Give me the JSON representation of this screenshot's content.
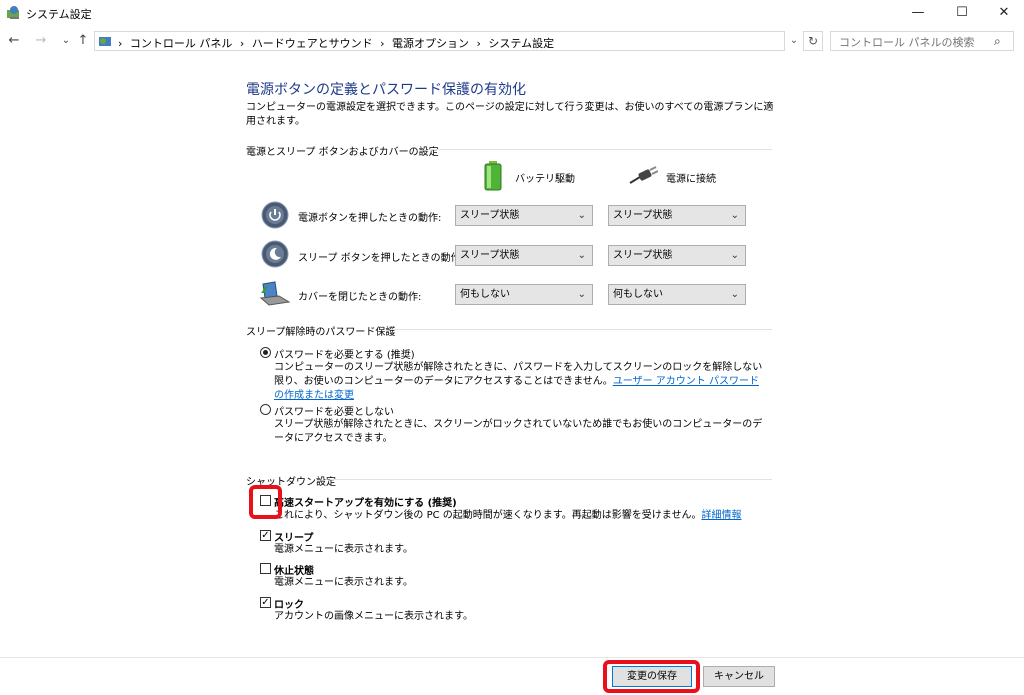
{
  "window": {
    "title": "システム設定",
    "minimize": "—",
    "maximize": "☐",
    "close": "✕"
  },
  "nav": {
    "back": "←",
    "forward": "→",
    "recent": "⌄",
    "up": "↑"
  },
  "address": {
    "crumbs": [
      "›",
      "コントロール パネル",
      "›",
      "ハードウェアとサウンド",
      "›",
      "電源オプション",
      "›",
      "システム設定"
    ],
    "dropdown": "⌄",
    "refresh": "↻"
  },
  "search": {
    "placeholder": "コントロール パネルの検索",
    "icon": "⌕"
  },
  "main": {
    "title": "電源ボタンの定義とパスワード保護の有効化",
    "description": "コンピューターの電源設定を選択できます。このページの設定に対して行う変更は、お使いのすべての電源プランに適用されます。",
    "power_section": {
      "heading": "電源とスリープ ボタンおよびカバーの設定",
      "battery_label": "バッテリ駆動",
      "plugged_label": "電源に接続",
      "rows": [
        {
          "label": "電源ボタンを押したときの動作:",
          "battery": "スリープ状態",
          "plugged": "スリープ状態"
        },
        {
          "label": "スリープ ボタンを押したときの動作:",
          "battery": "スリープ状態",
          "plugged": "スリープ状態"
        },
        {
          "label": "カバーを閉じたときの動作:",
          "battery": "何もしない",
          "plugged": "何もしない"
        }
      ]
    },
    "password_section": {
      "heading": "スリープ解除時のパスワード保護",
      "require": {
        "title": "パスワードを必要とする (推奨)",
        "desc": "コンピューターのスリープ状態が解除されたときに、パスワードを入力してスクリーンのロックを解除しない限り、お使いのコンピューターのデータにアクセスすることはできません。",
        "link": "ユーザー アカウント パスワードの作成または変更",
        "selected": true
      },
      "not_require": {
        "title": "パスワードを必要としない",
        "desc": "スリープ状態が解除されたときに、スクリーンがロックされていないため誰でもお使いのコンピューターのデータにアクセスできます。",
        "selected": false
      }
    },
    "shutdown_section": {
      "heading": "シャットダウン設定",
      "options": [
        {
          "title": "高速スタートアップを有効にする (推奨)",
          "desc": "これにより、シャットダウン後の PC の起動時間が速くなります。再起動は影響を受けません。",
          "link": "詳細情報",
          "checked": false
        },
        {
          "title": "スリープ",
          "desc": "電源メニューに表示されます。",
          "checked": true
        },
        {
          "title": "休止状態",
          "desc": "電源メニューに表示されます。",
          "checked": false
        },
        {
          "title": "ロック",
          "desc": "アカウントの画像メニューに表示されます。",
          "checked": true
        }
      ]
    }
  },
  "footer": {
    "save": "変更の保存",
    "cancel": "キャンセル"
  },
  "colors": {
    "title": "#1e3a8a",
    "link": "#0066cc",
    "highlight": "#e8101a"
  }
}
